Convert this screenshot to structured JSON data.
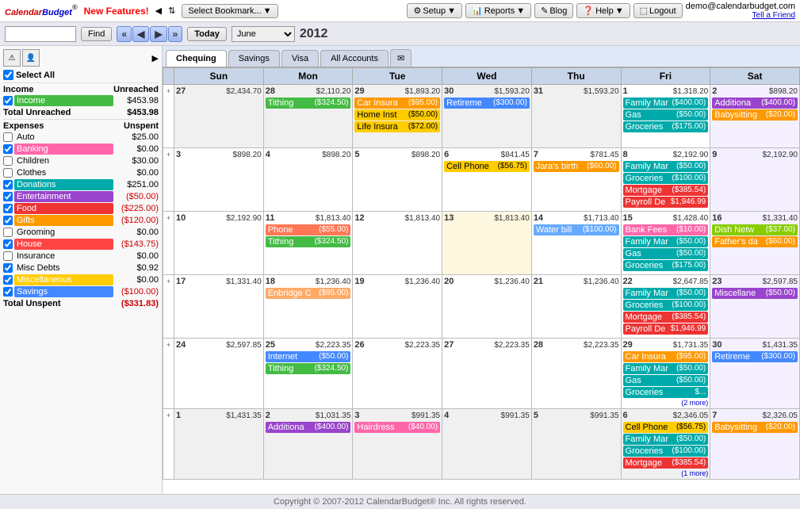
{
  "app": {
    "name_cal": "Calendar",
    "name_budget": "Budget",
    "trademark": "®",
    "new_features": "New Features!",
    "select_bookmark": "Select Bookmark...",
    "setup": "Setup",
    "reports": "Reports",
    "blog": "Blog",
    "help": "Help",
    "logout": "Logout",
    "user_email": "demo@calendarbudget.com",
    "tell_friend": "Tell a Friend"
  },
  "nav": {
    "find_placeholder": "",
    "find_btn": "Find",
    "today_btn": "Today",
    "month": "June",
    "year": "2012"
  },
  "tabs": [
    {
      "id": "chequing",
      "label": "Chequing",
      "active": true
    },
    {
      "id": "savings",
      "label": "Savings",
      "active": false
    },
    {
      "id": "visa",
      "label": "Visa",
      "active": false
    },
    {
      "id": "all-accounts",
      "label": "All Accounts",
      "active": false
    }
  ],
  "sidebar": {
    "income_header": "Income",
    "income_unreached_header": "Unreached",
    "income_items": [
      {
        "label": "Income",
        "color": "#44bb44",
        "amount": "$453.98",
        "checked": true
      }
    ],
    "total_unreached_label": "Total Unreached",
    "total_unreached": "$453.98",
    "expenses_header": "Expenses",
    "expenses_unspent_header": "Unspent",
    "expense_items": [
      {
        "label": "Auto",
        "color": null,
        "amount": "$25.00",
        "checked": false
      },
      {
        "label": "Banking",
        "color": "#ff66aa",
        "amount": "$0.00",
        "checked": true
      },
      {
        "label": "Children",
        "color": null,
        "amount": "$30.00",
        "checked": false
      },
      {
        "label": "Clothes",
        "color": null,
        "amount": "$0.00",
        "checked": false
      },
      {
        "label": "Donations",
        "color": "#00aaaa",
        "amount": "$251.00",
        "checked": true
      },
      {
        "label": "Entertainment",
        "color": "#9944cc",
        "amount": "($50.00)",
        "checked": true,
        "red": true
      },
      {
        "label": "Food",
        "color": "#ee3333",
        "amount": "($225.00)",
        "checked": true,
        "red": true
      },
      {
        "label": "Gifts",
        "color": "#ff9900",
        "amount": "($120.00)",
        "checked": true,
        "red": true
      },
      {
        "label": "Grooming",
        "color": null,
        "amount": "$0.00",
        "checked": false
      },
      {
        "label": "House",
        "color": "#ff4444",
        "amount": "($143.75)",
        "checked": true,
        "red": true
      },
      {
        "label": "Insurance",
        "color": null,
        "amount": "$0.00",
        "checked": false
      },
      {
        "label": "Misc Debts",
        "color": null,
        "amount": "$0.92",
        "checked": true
      },
      {
        "label": "Miscellaneous",
        "color": "#ffcc00",
        "amount": "$0.00",
        "checked": true
      },
      {
        "label": "Savings",
        "color": "#4488ff",
        "amount": "($100.00)",
        "checked": true,
        "red": true
      }
    ],
    "total_unspent_label": "Total Unspent",
    "total_unspent": "($331.83)"
  },
  "calendar": {
    "days": [
      "Sun",
      "Mon",
      "Tue",
      "Wed",
      "Thu",
      "Fri",
      "Sat"
    ],
    "weeks": [
      {
        "cells": [
          {
            "day": "27",
            "other": true,
            "total": "$2,434.70",
            "events": []
          },
          {
            "day": "28",
            "other": true,
            "total": "$2,110.20",
            "events": [
              {
                "name": "Tithing",
                "amount": "($324.50)",
                "color": "ev-green"
              }
            ]
          },
          {
            "day": "29",
            "other": true,
            "total": "$1,893.20",
            "events": [
              {
                "name": "Car Insura",
                "amount": "($95.00)",
                "color": "ev-orange"
              },
              {
                "name": "Home Inst",
                "amount": "($50.00)",
                "color": "ev-yellow"
              },
              {
                "name": "Life Insura",
                "amount": "($72.00)",
                "color": "ev-yellow"
              }
            ]
          },
          {
            "day": "30",
            "other": true,
            "total": "$1,593.20",
            "events": [
              {
                "name": "Retireme",
                "amount": "($300.00)",
                "color": "ev-blue"
              }
            ]
          },
          {
            "day": "31",
            "other": true,
            "total": "$1,593.20",
            "events": []
          },
          {
            "day": "1",
            "total": "$1,318.20",
            "events": [
              {
                "name": "Family Mar",
                "amount": "($400.00)",
                "color": "ev-teal"
              },
              {
                "name": "Gas",
                "amount": "($50.00)",
                "color": "ev-teal"
              },
              {
                "name": "Groceries",
                "amount": "($175.00)",
                "color": "ev-teal"
              }
            ]
          },
          {
            "day": "2",
            "weekend": true,
            "total": "$898.20",
            "events": [
              {
                "name": "Additiona",
                "amount": "($400.00)",
                "color": "ev-purple"
              },
              {
                "name": "Babysitting",
                "amount": "($20.00)",
                "color": "ev-orange"
              }
            ]
          }
        ]
      },
      {
        "cells": [
          {
            "day": "3",
            "total": "$898.20",
            "events": []
          },
          {
            "day": "4",
            "total": "$898.20",
            "events": []
          },
          {
            "day": "5",
            "total": "$898.20",
            "events": []
          },
          {
            "day": "6",
            "total": "$841.45",
            "events": [
              {
                "name": "Cell Phone",
                "amount": "($56.75)",
                "color": "ev-yellow"
              }
            ]
          },
          {
            "day": "7",
            "total": "$781.45",
            "events": [
              {
                "name": "Jara's birth",
                "amount": "($60.00)",
                "color": "ev-orange"
              }
            ]
          },
          {
            "day": "8",
            "total": "$2,192.90",
            "events": [
              {
                "name": "Family Mar",
                "amount": "($50.00)",
                "color": "ev-teal"
              },
              {
                "name": "Groceries",
                "amount": "($100.00)",
                "color": "ev-teal"
              },
              {
                "name": "Mortgage",
                "amount": "($385.54)",
                "color": "ev-red"
              },
              {
                "name": "Payroll De",
                "amount": "$1,946.99",
                "color": "ev-red"
              }
            ]
          },
          {
            "day": "9",
            "weekend": true,
            "total": "$2,192.90",
            "events": []
          }
        ]
      },
      {
        "cells": [
          {
            "day": "10",
            "total": "$2,192.90",
            "events": []
          },
          {
            "day": "11",
            "total": "$1,813.40",
            "events": [
              {
                "name": "Phone",
                "amount": "($55.00)",
                "color": "ev-salmon"
              },
              {
                "name": "Tithing",
                "amount": "($324.50)",
                "color": "ev-green"
              }
            ]
          },
          {
            "day": "12",
            "total": "$1,813.40",
            "events": []
          },
          {
            "day": "13",
            "total": "$1,813.40",
            "events": [],
            "highlight": "#fff8e0"
          },
          {
            "day": "14",
            "total": "$1,713.40",
            "events": [
              {
                "name": "Water bill",
                "amount": "($100.00)",
                "color": "ev-lightblue"
              }
            ]
          },
          {
            "day": "15",
            "total": "$1,428.40",
            "events": [
              {
                "name": "Bank Fees",
                "amount": "($10.00)",
                "color": "ev-pink"
              },
              {
                "name": "Family Mar",
                "amount": "($50.00)",
                "color": "ev-teal"
              },
              {
                "name": "Gas",
                "amount": "($50.00)",
                "color": "ev-teal"
              },
              {
                "name": "Groceries",
                "amount": "($175.00)",
                "color": "ev-teal"
              }
            ]
          },
          {
            "day": "16",
            "weekend": true,
            "total": "$1,331.40",
            "events": [
              {
                "name": "Dish Netw",
                "amount": "($37.00)",
                "color": "ev-lime"
              },
              {
                "name": "Father's da",
                "amount": "($60.00)",
                "color": "ev-orange"
              }
            ]
          }
        ]
      },
      {
        "cells": [
          {
            "day": "17",
            "total": "$1,331.40",
            "events": []
          },
          {
            "day": "18",
            "total": "$1,236.40",
            "events": [
              {
                "name": "Enbridge C",
                "amount": "($95.00)",
                "color": "ev-peach"
              }
            ]
          },
          {
            "day": "19",
            "total": "$1,236.40",
            "events": []
          },
          {
            "day": "20",
            "total": "$1,236.40",
            "events": []
          },
          {
            "day": "21",
            "total": "$1,236.40",
            "events": []
          },
          {
            "day": "22",
            "total": "$2,647.85",
            "events": [
              {
                "name": "Family Mar",
                "amount": "($50.00)",
                "color": "ev-teal"
              },
              {
                "name": "Groceries",
                "amount": "($100.00)",
                "color": "ev-teal"
              },
              {
                "name": "Mortgage",
                "amount": "($385.54)",
                "color": "ev-red"
              },
              {
                "name": "Payroll De",
                "amount": "$1,946.99",
                "color": "ev-red"
              }
            ]
          },
          {
            "day": "23",
            "weekend": true,
            "total": "$2,597.85",
            "events": [
              {
                "name": "Miscellane",
                "amount": "($50.00)",
                "color": "ev-purple"
              }
            ]
          }
        ]
      },
      {
        "cells": [
          {
            "day": "24",
            "total": "$2,597.85",
            "events": []
          },
          {
            "day": "25",
            "total": "$2,223.35",
            "events": [
              {
                "name": "Internet",
                "amount": "($50.00)",
                "color": "ev-blue"
              },
              {
                "name": "Tithing",
                "amount": "($324.50)",
                "color": "ev-green"
              }
            ]
          },
          {
            "day": "26",
            "total": "$2,223.35",
            "events": []
          },
          {
            "day": "27",
            "total": "$2,223.35",
            "events": []
          },
          {
            "day": "28",
            "total": "$2,223.35",
            "events": []
          },
          {
            "day": "29",
            "total": "$1,731.35",
            "events": [
              {
                "name": "Car Insura",
                "amount": "($95.00)",
                "color": "ev-orange"
              },
              {
                "name": "Family Mar",
                "amount": "($50.00)",
                "color": "ev-teal"
              },
              {
                "name": "Gas",
                "amount": "($50.00)",
                "color": "ev-teal"
              },
              {
                "name": "Groceries",
                "amount": "$...",
                "color": "ev-teal"
              },
              {
                "name": "(2 more)",
                "amount": "",
                "color": "",
                "more": true
              }
            ]
          },
          {
            "day": "30",
            "weekend": true,
            "total": "$1,431.35",
            "events": [
              {
                "name": "Retireme",
                "amount": "($300.00)",
                "color": "ev-blue"
              }
            ]
          }
        ]
      },
      {
        "cells": [
          {
            "day": "1",
            "other": true,
            "total": "$1,431.35",
            "events": []
          },
          {
            "day": "2",
            "other": true,
            "total": "$1,031.35",
            "events": [
              {
                "name": "Additiona",
                "amount": "($400.00)",
                "color": "ev-purple"
              }
            ]
          },
          {
            "day": "3",
            "other": true,
            "total": "$991.35",
            "events": [
              {
                "name": "Hairdress",
                "amount": "($40.00)",
                "color": "ev-pink"
              }
            ]
          },
          {
            "day": "4",
            "other": true,
            "total": "$991.35",
            "events": []
          },
          {
            "day": "5",
            "other": true,
            "total": "$991.35",
            "events": []
          },
          {
            "day": "6",
            "other": true,
            "total": "$2,346.05",
            "events": [
              {
                "name": "Cell Phone",
                "amount": "($56.75)",
                "color": "ev-yellow"
              },
              {
                "name": "Family Mar",
                "amount": "($50.00)",
                "color": "ev-teal"
              },
              {
                "name": "Groceries",
                "amount": "($100.00)",
                "color": "ev-teal"
              },
              {
                "name": "Mortgage",
                "amount": "($385.54)",
                "color": "ev-red"
              },
              {
                "name": "(1 more)",
                "amount": "",
                "color": "",
                "more": true
              }
            ]
          },
          {
            "day": "7",
            "other": true,
            "weekend": true,
            "total": "$2,326.05",
            "events": [
              {
                "name": "Babysitting",
                "amount": "($20.00)",
                "color": "ev-orange"
              }
            ]
          }
        ]
      }
    ]
  },
  "footer": {
    "text": "Copyright © 2007-2012 CalendarBudget® Inc. All rights reserved."
  }
}
